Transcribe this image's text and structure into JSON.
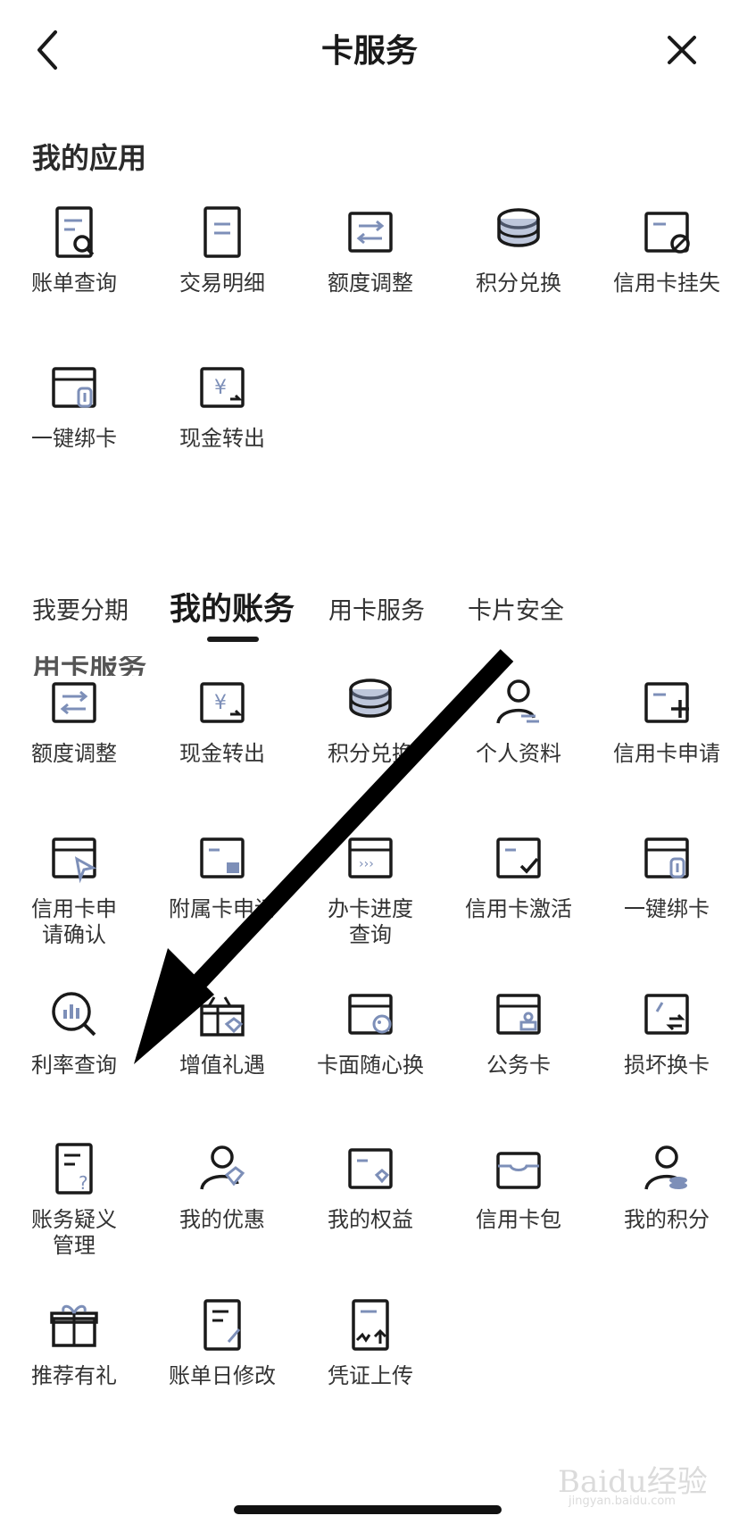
{
  "header": {
    "title": "卡服务"
  },
  "my_apps": {
    "title": "我的应用",
    "items": [
      {
        "label": "账单查询",
        "icon": "bill-search-icon"
      },
      {
        "label": "交易明细",
        "icon": "transaction-detail-icon"
      },
      {
        "label": "额度调整",
        "icon": "limit-adjust-icon"
      },
      {
        "label": "积分兑换",
        "icon": "points-exchange-icon"
      },
      {
        "label": "信用卡挂失",
        "icon": "card-report-loss-icon"
      },
      {
        "label": "一键绑卡",
        "icon": "card-bind-icon"
      },
      {
        "label": "现金转出",
        "icon": "cash-transfer-icon"
      }
    ]
  },
  "tabs": [
    {
      "label": "我要分期"
    },
    {
      "label": "我的账务",
      "active": true
    },
    {
      "label": "用卡服务"
    },
    {
      "label": "卡片安全"
    }
  ],
  "card_service": {
    "title": "用卡服务",
    "items": [
      {
        "label": "额度调整",
        "icon": "limit-adjust-icon"
      },
      {
        "label": "现金转出",
        "icon": "cash-transfer-icon"
      },
      {
        "label": "积分兑换",
        "icon": "points-exchange-icon"
      },
      {
        "label": "个人资料",
        "icon": "profile-icon"
      },
      {
        "label": "信用卡申请",
        "icon": "card-apply-icon"
      },
      {
        "label": "信用卡申\n请确认",
        "icon": "card-apply-confirm-icon"
      },
      {
        "label": "附属卡申请",
        "icon": "supplementary-card-icon"
      },
      {
        "label": "办卡进度\n查询",
        "icon": "card-progress-icon"
      },
      {
        "label": "信用卡激活",
        "icon": "card-activate-icon"
      },
      {
        "label": "一键绑卡",
        "icon": "card-bind-icon"
      },
      {
        "label": "利率查询",
        "icon": "rate-search-icon"
      },
      {
        "label": "增值礼遇",
        "icon": "gift-perk-icon"
      },
      {
        "label": "卡面随心换",
        "icon": "card-face-icon"
      },
      {
        "label": "公务卡",
        "icon": "business-card-icon"
      },
      {
        "label": "损坏换卡",
        "icon": "card-replace-icon"
      },
      {
        "label": "账务疑义\n管理",
        "icon": "dispute-icon"
      },
      {
        "label": "我的优惠",
        "icon": "my-coupon-icon"
      },
      {
        "label": "我的权益",
        "icon": "my-rights-icon"
      },
      {
        "label": "信用卡包",
        "icon": "card-wallet-icon"
      },
      {
        "label": "我的积分",
        "icon": "my-points-icon"
      },
      {
        "label": "推荐有礼",
        "icon": "referral-gift-icon"
      },
      {
        "label": "账单日修改",
        "icon": "bill-date-edit-icon"
      },
      {
        "label": "凭证上传",
        "icon": "voucher-upload-icon"
      }
    ]
  },
  "watermark": {
    "text": "Baidu经验",
    "sub": "jingyan.baidu.com"
  },
  "colors": {
    "icon_dark": "#1a1a1a",
    "icon_accent": "#7d8fb8",
    "arrow": "#000000"
  }
}
